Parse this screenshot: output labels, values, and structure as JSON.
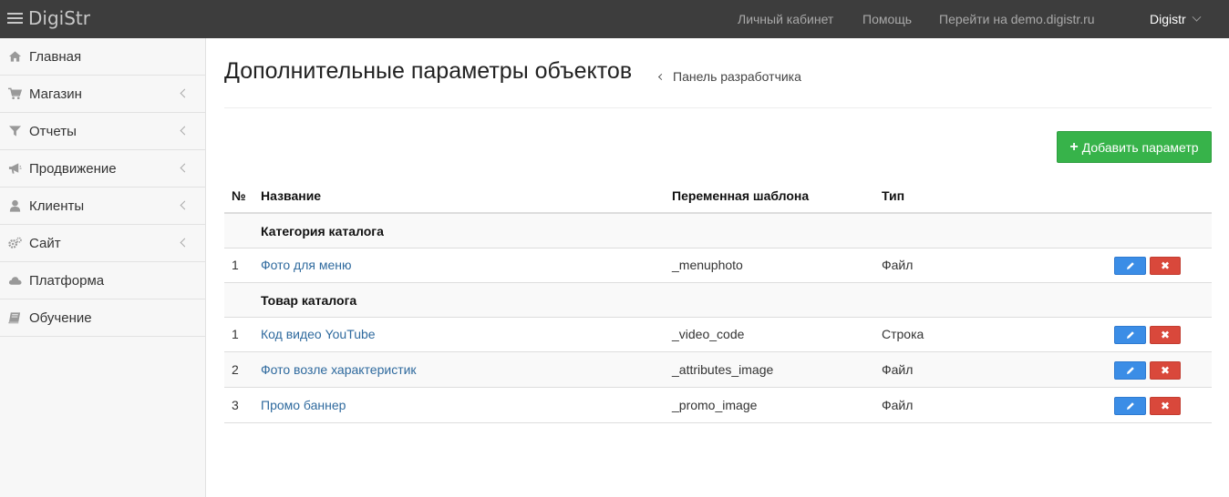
{
  "app": {
    "name": "DigiStr"
  },
  "topnav": {
    "cabinet": "Личный кабинет",
    "help": "Помощь",
    "demo": "Перейти на demo.digistr.ru",
    "user": "Digistr"
  },
  "sidebar": {
    "items": [
      {
        "label": "Главная",
        "icon": "home-icon",
        "has_submenu": false
      },
      {
        "label": "Магазин",
        "icon": "cart-icon",
        "has_submenu": true
      },
      {
        "label": "Отчеты",
        "icon": "filter-icon",
        "has_submenu": true
      },
      {
        "label": "Продвижение",
        "icon": "bullhorn-icon",
        "has_submenu": true
      },
      {
        "label": "Клиенты",
        "icon": "user-icon",
        "has_submenu": true
      },
      {
        "label": "Сайт",
        "icon": "gears-icon",
        "has_submenu": true
      },
      {
        "label": "Платформа",
        "icon": "cloud-icon",
        "has_submenu": false
      },
      {
        "label": "Обучение",
        "icon": "book-icon",
        "has_submenu": false
      }
    ]
  },
  "main": {
    "title": "Дополнительные параметры объектов",
    "breadcrumb": "Панель разработчика",
    "add_button": "Добавить параметр"
  },
  "table": {
    "headers": {
      "num": "№",
      "name": "Название",
      "var": "Переменная шаблона",
      "type": "Тип"
    },
    "groups": [
      {
        "title": "Категория каталога",
        "rows": [
          {
            "num": "1",
            "name": "Фото для меню",
            "var": "_menuphoto",
            "type": "Файл"
          }
        ]
      },
      {
        "title": "Товар каталога",
        "rows": [
          {
            "num": "1",
            "name": "Код видео YouTube",
            "var": "_video_code",
            "type": "Строка"
          },
          {
            "num": "2",
            "name": "Фото возле характеристик",
            "var": "_attributes_image",
            "type": "Файл"
          },
          {
            "num": "3",
            "name": "Промо баннер",
            "var": "_promo_image",
            "type": "Файл"
          }
        ]
      }
    ]
  },
  "colors": {
    "topbar": "#3d3d3d",
    "add_button": "#37b34a",
    "edit_button": "#3b8de6",
    "delete_button": "#d9483b",
    "link": "#2f6a9e"
  }
}
